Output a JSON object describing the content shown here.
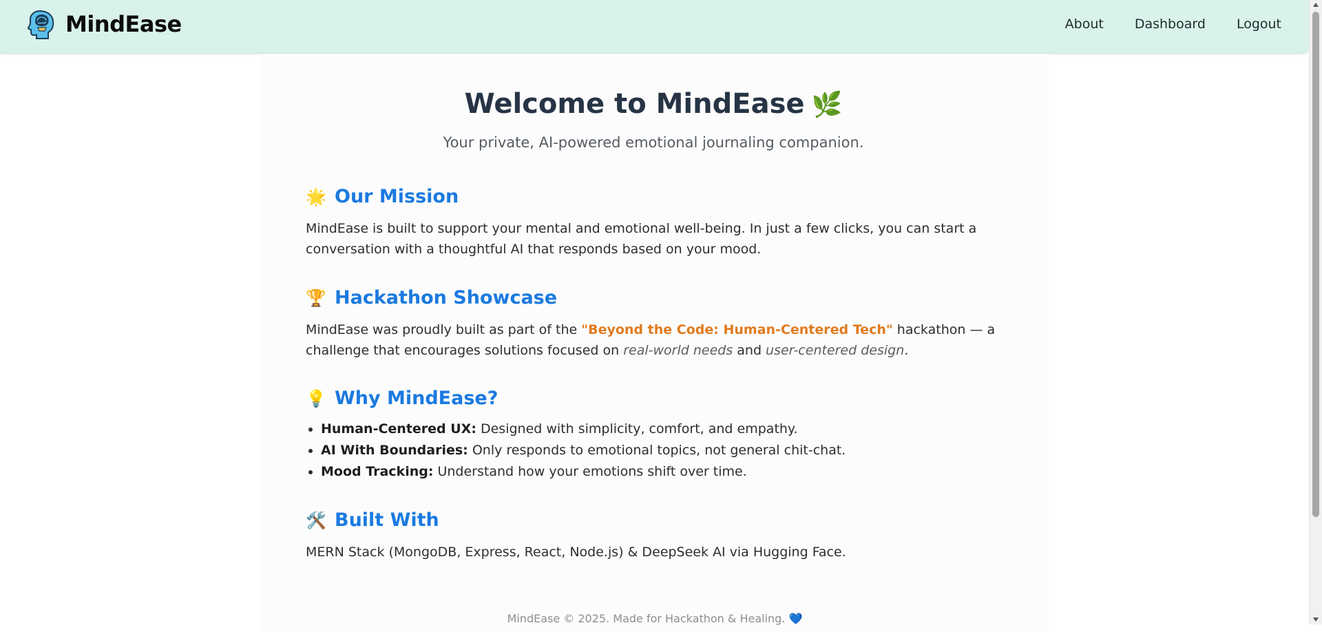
{
  "nav": {
    "brand": "MindEase",
    "links": [
      "About",
      "Dashboard",
      "Logout"
    ]
  },
  "hero": {
    "title": "Welcome to MindEase",
    "title_emoji": "🌿",
    "subtitle": "Your private, AI-powered emotional journaling companion."
  },
  "sections": {
    "mission": {
      "icon": "🌟",
      "heading": "Our Mission",
      "text": "MindEase is built to support your mental and emotional well-being. In just a few clicks, you can start a conversation with a thoughtful AI that responds based on your mood."
    },
    "hackathon": {
      "icon": "🏆",
      "heading": "Hackathon Showcase",
      "text_before": "MindEase was proudly built as part of the ",
      "highlight": "\"Beyond the Code: Human-Centered Tech\"",
      "text_middle": " hackathon — a challenge that encourages solutions focused on ",
      "em1": "real-world needs",
      "text_and": " and ",
      "em2": "user-centered design",
      "text_end": "."
    },
    "why": {
      "icon": "💡",
      "heading": "Why MindEase?",
      "items": [
        {
          "label": "Human-Centered UX:",
          "text": " Designed with simplicity, comfort, and empathy."
        },
        {
          "label": "AI With Boundaries:",
          "text": " Only responds to emotional topics, not general chit-chat."
        },
        {
          "label": "Mood Tracking:",
          "text": " Understand how your emotions shift over time."
        }
      ]
    },
    "built": {
      "icon": "🛠️",
      "heading": "Built With",
      "text": "MERN Stack (MongoDB, Express, React, Node.js) & DeepSeek AI via Hugging Face."
    }
  },
  "footer": {
    "text": "MindEase © 2025. Made for Hackathon & Healing.",
    "emoji": "💙"
  },
  "colors": {
    "navbar_bg": "#d9f2ea",
    "heading_blue": "#1b7ae0",
    "highlight_orange": "#e07b1f",
    "title_dark": "#263445"
  },
  "icons": {
    "brand": "brain-head-logo-icon"
  }
}
